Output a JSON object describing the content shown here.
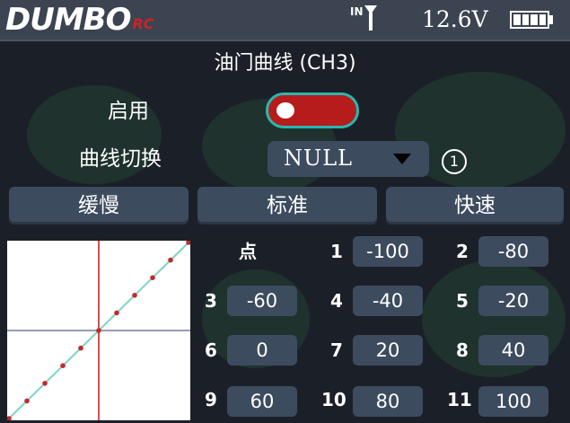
{
  "status_bar": {
    "brand": "DUMBO",
    "brand_suffix": "RC",
    "antenna_label": "IN",
    "voltage": "12.6V",
    "battery_icon": "battery-full-icon",
    "antenna_icon": "antenna-icon"
  },
  "page": {
    "title": "油门曲线 (CH3)"
  },
  "settings": {
    "enable_label": "启用",
    "enable_state": "on",
    "curve_switch_label": "曲线切换",
    "curve_switch_value": "NULL",
    "curve_index": "①"
  },
  "presets": [
    "缓慢",
    "标准",
    "快速"
  ],
  "points_header": "点",
  "points": [
    {
      "label": "1",
      "value": "-100"
    },
    {
      "label": "2",
      "value": "-80"
    },
    {
      "label": "3",
      "value": "-60"
    },
    {
      "label": "4",
      "value": "-40"
    },
    {
      "label": "5",
      "value": "-20"
    },
    {
      "label": "6",
      "value": "0"
    },
    {
      "label": "7",
      "value": "20"
    },
    {
      "label": "8",
      "value": "40"
    },
    {
      "label": "9",
      "value": "60"
    },
    {
      "label": "10",
      "value": "80"
    },
    {
      "label": "11",
      "value": "100"
    }
  ],
  "curve": {
    "inputs": [
      -100,
      -80,
      -60,
      -40,
      -20,
      0,
      20,
      40,
      60,
      80,
      100
    ],
    "outputs": [
      -100,
      -80,
      -60,
      -40,
      -20,
      0,
      20,
      40,
      60,
      80,
      100
    ],
    "range": [
      -100,
      100
    ],
    "line_color": "#7fd3c4",
    "point_color": "#c62828",
    "axis_color": "#b71c1c"
  },
  "colors": {
    "accent": "#29b7b0",
    "toggle_on": "#b71c1c",
    "panel": "#3d4b5f"
  }
}
